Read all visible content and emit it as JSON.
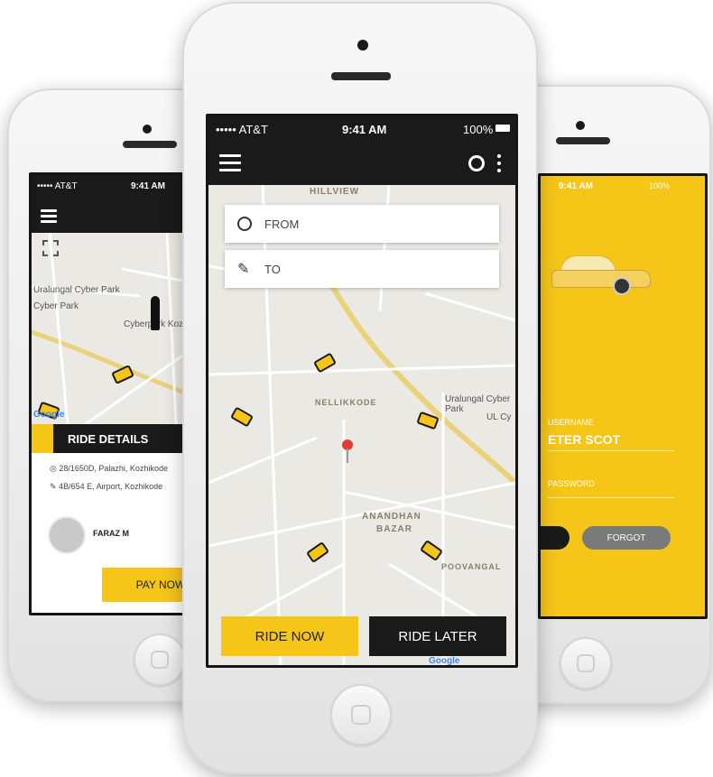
{
  "colors": {
    "accent": "#f5c518",
    "dark": "#1a1a1a",
    "map": "#ebe9e4"
  },
  "center": {
    "status": {
      "carrier": "••••• AT&T",
      "time": "9:41 AM",
      "battery": "100%"
    },
    "icons": {
      "menu": "menu-icon",
      "refresh": "refresh-icon",
      "more": "more-icon"
    },
    "from_label": "FROM",
    "to_label": "TO",
    "map_labels": {
      "hillview": "HILLVIEW",
      "nellikkode": "NELLIKKODE",
      "uralungal": "Uralungal Cyber Park",
      "ul": "UL Cy",
      "anandhan": "ANANDHAN",
      "bazar": "BAZAR",
      "poovangal": "POOVANGAL",
      "google": "Google"
    },
    "ride_now": "RIDE NOW",
    "ride_later": "RIDE LATER"
  },
  "left": {
    "status": {
      "carrier": "••••• AT&T",
      "time": "9:41 AM"
    },
    "map_labels": {
      "uralungal": "Uralungal Cyber Park",
      "cyber": "Cyber Park",
      "cyberpark2": "Cyberpark Kozh",
      "google": "Google"
    },
    "ride_details": "RIDE DETAILS",
    "from_address": "28/1650D, Palazhi, Kozhikode",
    "to_address": "4B/654 E, Airport, Kozhikode",
    "driver_name": "FARAZ M",
    "pay_now": "PAY NOW"
  },
  "right": {
    "status": {
      "time": "9:41 AM",
      "battery": "100%"
    },
    "username_label": "USERNAME",
    "username_value": "ETER SCOT",
    "password_label": "PASSWORD",
    "forgot": "FORGOT"
  }
}
